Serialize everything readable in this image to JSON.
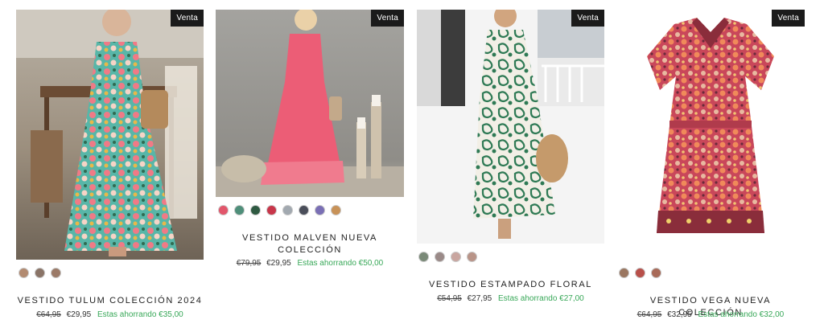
{
  "products": [
    {
      "badge": "Venta",
      "title": "VESTIDO TULUM COLECCIÓN 2024",
      "old_price": "€64,95",
      "price": "€29,95",
      "savings": "Estas ahorrando €35,00",
      "swatches": [
        "#b28a70",
        "#8a7467",
        "#9b7a67"
      ]
    },
    {
      "badge": "Venta",
      "title_line1": "VESTIDO MALVEN NUEVA",
      "title_line2": "COLECCIÓN",
      "old_price": "€79,95",
      "price": "€29,95",
      "savings": "Estas ahorrando €50,00",
      "swatches": [
        "#e2566b",
        "#4f8f7a",
        "#2f5a42",
        "#c8364a",
        "#a2a9b0",
        "#4a4e5a",
        "#7a6fb5",
        "#c89258"
      ]
    },
    {
      "badge": "Venta",
      "title": "VESTIDO ESTAMPADO FLORAL",
      "old_price": "€54,95",
      "price": "€27,95",
      "savings": "Estas ahorrando €27,00",
      "swatches": [
        "#7a8a78",
        "#9a8a88",
        "#c9a6a0",
        "#b99488"
      ]
    },
    {
      "badge": "Venta",
      "title": "VESTIDO VEGA NUEVA COLECCIÓN",
      "old_price": "€64,95",
      "price": "€32,95",
      "savings": "Estas ahorrando €32,00",
      "swatches": [
        "#9a7660",
        "#b8504a",
        "#a86a58"
      ]
    }
  ]
}
